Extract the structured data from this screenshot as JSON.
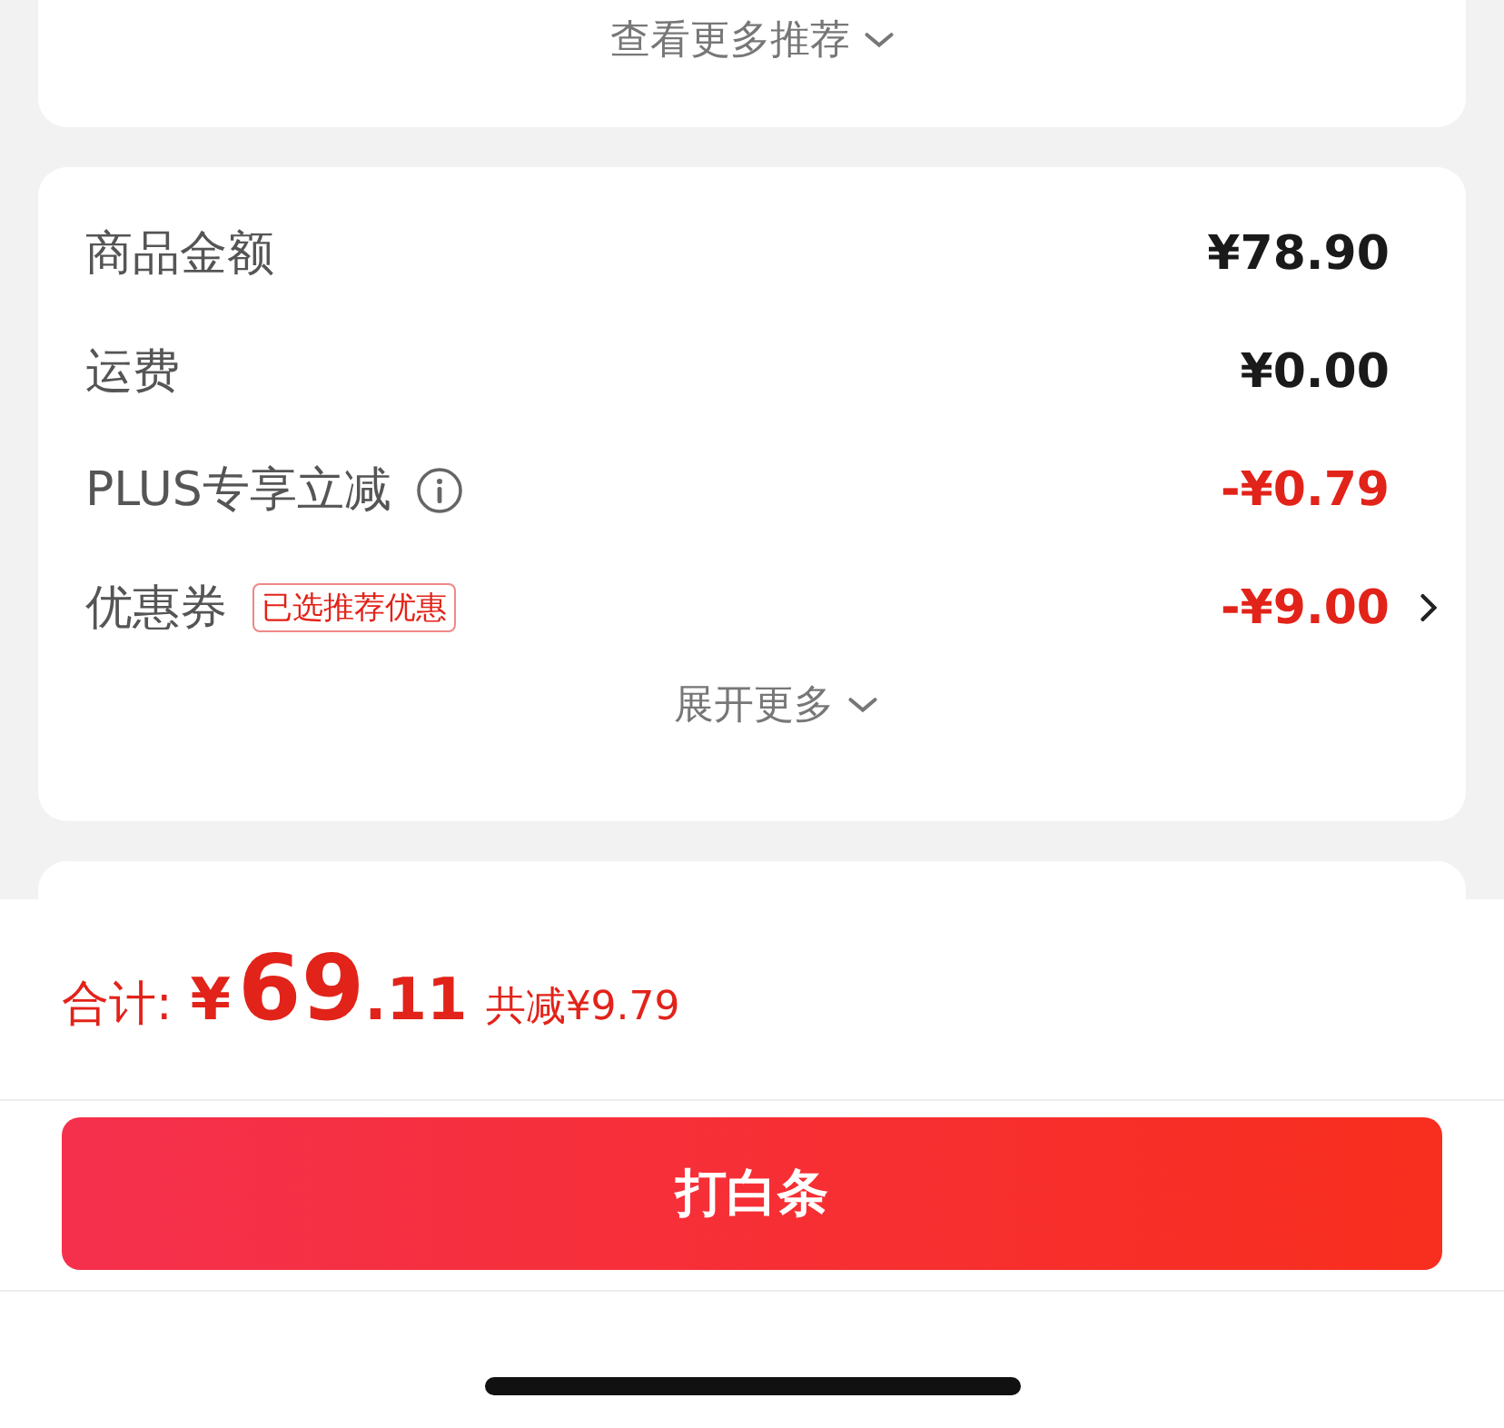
{
  "recommendations": {
    "more_label": "查看更多推荐"
  },
  "summary": {
    "rows": [
      {
        "label": "商品金额",
        "amount": "¥78.90",
        "discount": false,
        "info": false,
        "arrow": false
      },
      {
        "label": "运费",
        "amount": "¥0.00",
        "discount": false,
        "info": false,
        "arrow": false
      },
      {
        "label": "PLUS专享立减",
        "amount": "-¥0.79",
        "discount": true,
        "info": true,
        "arrow": false
      },
      {
        "label": "优惠券",
        "tag": "已选推荐优惠",
        "amount": "-¥9.00",
        "discount": true,
        "info": false,
        "arrow": true
      }
    ],
    "expand_label": "展开更多"
  },
  "footer": {
    "total_label": "合计:",
    "currency": "¥",
    "total_integer": "69",
    "total_decimal": ".11",
    "savings": "共减¥9.79",
    "pay_button": "打白条"
  }
}
